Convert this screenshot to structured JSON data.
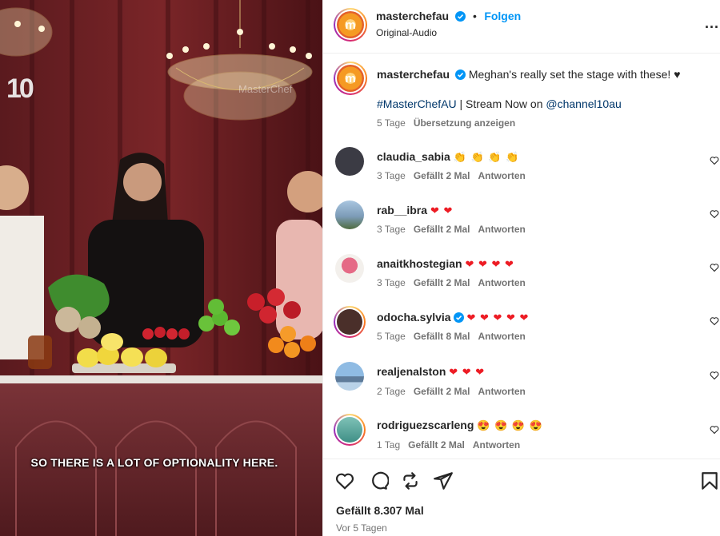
{
  "video": {
    "channel_logo": "10",
    "watermark": "MasterChef",
    "subtitle": "SO THERE IS A LOT OF OPTIONALITY HERE."
  },
  "post_header": {
    "username": "masterchefau",
    "separator": "•",
    "follow_label": "Folgen",
    "audio_label": "Original-Audio",
    "more_label": "..."
  },
  "caption": {
    "username": "masterchefau",
    "text": "Meghan's really set the stage with these! ♥",
    "hashtag": "#MasterChefAU",
    "middle": " | Stream Now on ",
    "mention": "@channel10au",
    "age": "5 Tage",
    "translate_label": "Übersetzung anzeigen"
  },
  "comments": [
    {
      "username": "claudia_sabia",
      "text": "👏 👏 👏 👏",
      "emoji_color": "yel",
      "age": "3 Tage",
      "likes": "Gefällt 2 Mal",
      "reply": "Antworten",
      "avatar_color": "#3b3b44"
    },
    {
      "username": "rab__ibra",
      "text": "❤ ❤",
      "emoji_color": "red",
      "age": "3 Tage",
      "likes": "Gefällt 2 Mal",
      "reply": "Antworten",
      "avatar_color": "#7d9cb8"
    },
    {
      "username": "anaitkhostegian",
      "text": "❤ ❤ ❤ ❤",
      "emoji_color": "red",
      "age": "3 Tage",
      "likes": "Gefällt 2 Mal",
      "reply": "Antworten",
      "avatar_color": "#d9869a"
    },
    {
      "username": "odocha.sylvia",
      "text": "❤ ❤ ❤ ❤ ❤",
      "emoji_color": "red",
      "age": "5 Tage",
      "likes": "Gefällt 8 Mal",
      "reply": "Antworten",
      "avatar_color": "#4a2f2a"
    },
    {
      "username": "realjenalston",
      "text": "❤ ❤ ❤",
      "emoji_color": "red",
      "age": "2 Tage",
      "likes": "Gefällt 2 Mal",
      "reply": "Antworten",
      "avatar_color": "#6f9fc9"
    },
    {
      "username": "rodriguezscarleng",
      "text": "😍 😍 😍 😍",
      "emoji_color": "red",
      "age": "1 Tag",
      "likes": "Gefällt 2 Mal",
      "reply": "Antworten",
      "avatar_color": "#3f8f86"
    }
  ],
  "footer": {
    "likes": "Gefällt 8.307 Mal",
    "posted": "Vor 5 Tagen"
  },
  "colors": {
    "link": "#00376b",
    "follow": "#0095f6",
    "muted": "#737373",
    "verified": "#0095f6"
  }
}
